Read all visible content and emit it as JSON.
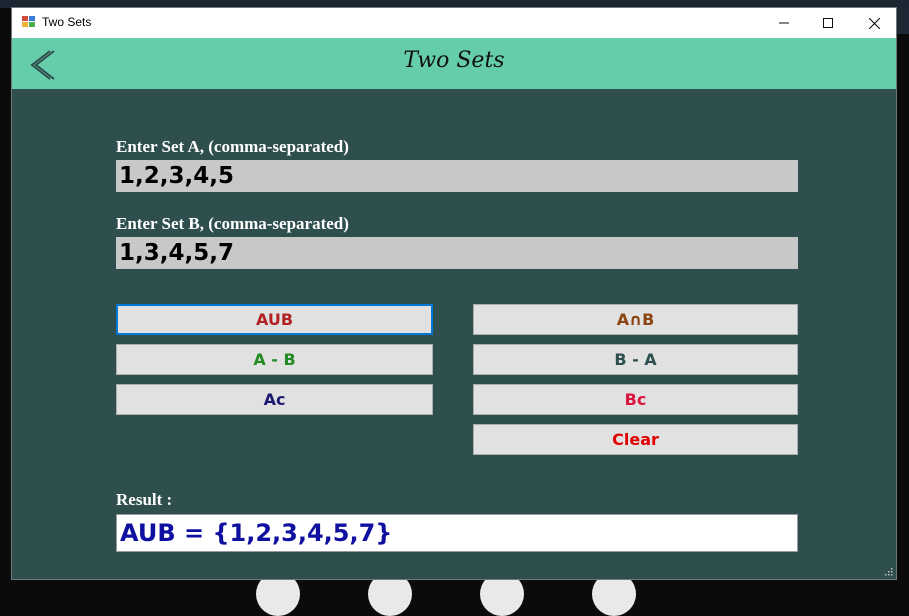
{
  "window": {
    "title": "Two Sets"
  },
  "header": {
    "title": "Two Sets",
    "back_icon": "chevron-left-icon"
  },
  "inputs": {
    "set_a_label": "Enter Set A, (comma-separated)",
    "set_a_value": "1,2,3,4,5",
    "set_b_label": "Enter Set B, (comma-separated)",
    "set_b_value": "1,3,4,5,7"
  },
  "buttons": {
    "union": "AUB",
    "intersection": "A∩B",
    "a_minus_b": "A - B",
    "b_minus_a": "B - A",
    "a_complement": "Ac",
    "b_complement": "Bc",
    "clear": "Clear"
  },
  "result": {
    "label": "Result :",
    "value": "AUB = {1,2,3,4,5,7}"
  },
  "colors": {
    "background": "#2f4f4f",
    "header": "#66cdaa",
    "union": "#b22222",
    "intersection": "#8b4513",
    "a_minus_b": "#228b22",
    "b_minus_a": "#2f4f4f",
    "a_complement": "#191970",
    "b_complement": "#dc143c",
    "clear": "#e00000",
    "result_text": "#1010a0"
  }
}
